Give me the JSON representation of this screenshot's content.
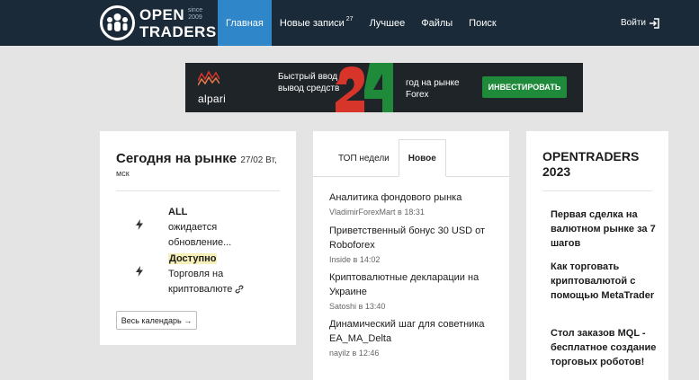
{
  "header": {
    "logo_line1": "OPEN",
    "logo_line2": "TRADERS",
    "logo_since": "since 2009",
    "nav": [
      {
        "label": "Главная",
        "badge": ""
      },
      {
        "label": "Новые записи",
        "badge": "27"
      },
      {
        "label": "Лучшее",
        "badge": ""
      },
      {
        "label": "Файлы",
        "badge": ""
      },
      {
        "label": "Поиск",
        "badge": ""
      }
    ],
    "login_label": "Войти"
  },
  "banner": {
    "brand": "alpari",
    "text1": "Быстрый ввод и вывод средств",
    "big_number": "24",
    "text2": "год на рынке Forex",
    "button_label": "ИНВЕСТИРОВАТЬ",
    "colors": {
      "bg": "#1f2428",
      "green": "#1f8a3a",
      "red": "#d8352a"
    }
  },
  "market": {
    "title": "Сегодня на рынке",
    "date": "27/02 Вт,",
    "tz": "мск",
    "events": [
      {
        "line1": "ALL",
        "line2": "ожидается обновление..."
      },
      {
        "line1": "Доступно",
        "line2": "Торговля на криптовалюте"
      }
    ],
    "calendar_button": "Весь календарь →"
  },
  "feed": {
    "tabs": [
      "ТОП недели",
      "Новое"
    ],
    "active_tab": 1,
    "posts": [
      {
        "title": "Аналитика фондового рынка",
        "author": "VladimirForexMart",
        "time": "в 18:31"
      },
      {
        "title": "Приветственный бонус 30 USD от Roboforex",
        "author": "Inside",
        "time": "в 14:02"
      },
      {
        "title": "Криптовалютные декларации на Украине",
        "author": "Satoshi",
        "time": "в 13:40"
      },
      {
        "title": "Динамический шаг для советника EA_MA_Delta",
        "author": "nayilz",
        "time": "в 12:46"
      }
    ]
  },
  "opentraders": {
    "title": "OPENTRADERS 2023",
    "items": [
      "Первая сделка на валютном рынке за 7 шагов",
      "Как торговать криптовалютой с помощью MetaTrader",
      "Стол заказов MQL - бесплатное создание торговых роботов!"
    ]
  }
}
